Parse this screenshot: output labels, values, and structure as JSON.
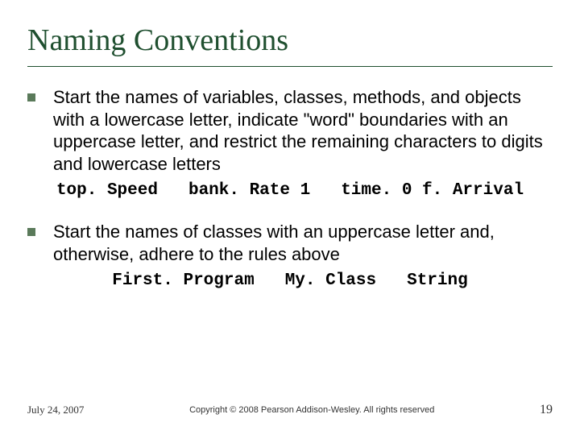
{
  "title": "Naming Conventions",
  "bullets": [
    {
      "text": "Start the names of variables, classes, methods, and objects with a lowercase letter, indicate \"word\" boundaries with an uppercase letter, and restrict the remaining characters to digits and lowercase letters",
      "codes": [
        "top. Speed",
        "bank. Rate 1",
        "time. 0 f. Arrival"
      ]
    },
    {
      "text": "Start the names of classes with an uppercase letter and, otherwise, adhere to the rules above",
      "codes": [
        "First. Program",
        "My. Class",
        "String"
      ]
    }
  ],
  "footer": {
    "date": "July 24, 2007",
    "copyright": "Copyright © 2008 Pearson Addison-Wesley. All rights reserved",
    "page": "19"
  }
}
